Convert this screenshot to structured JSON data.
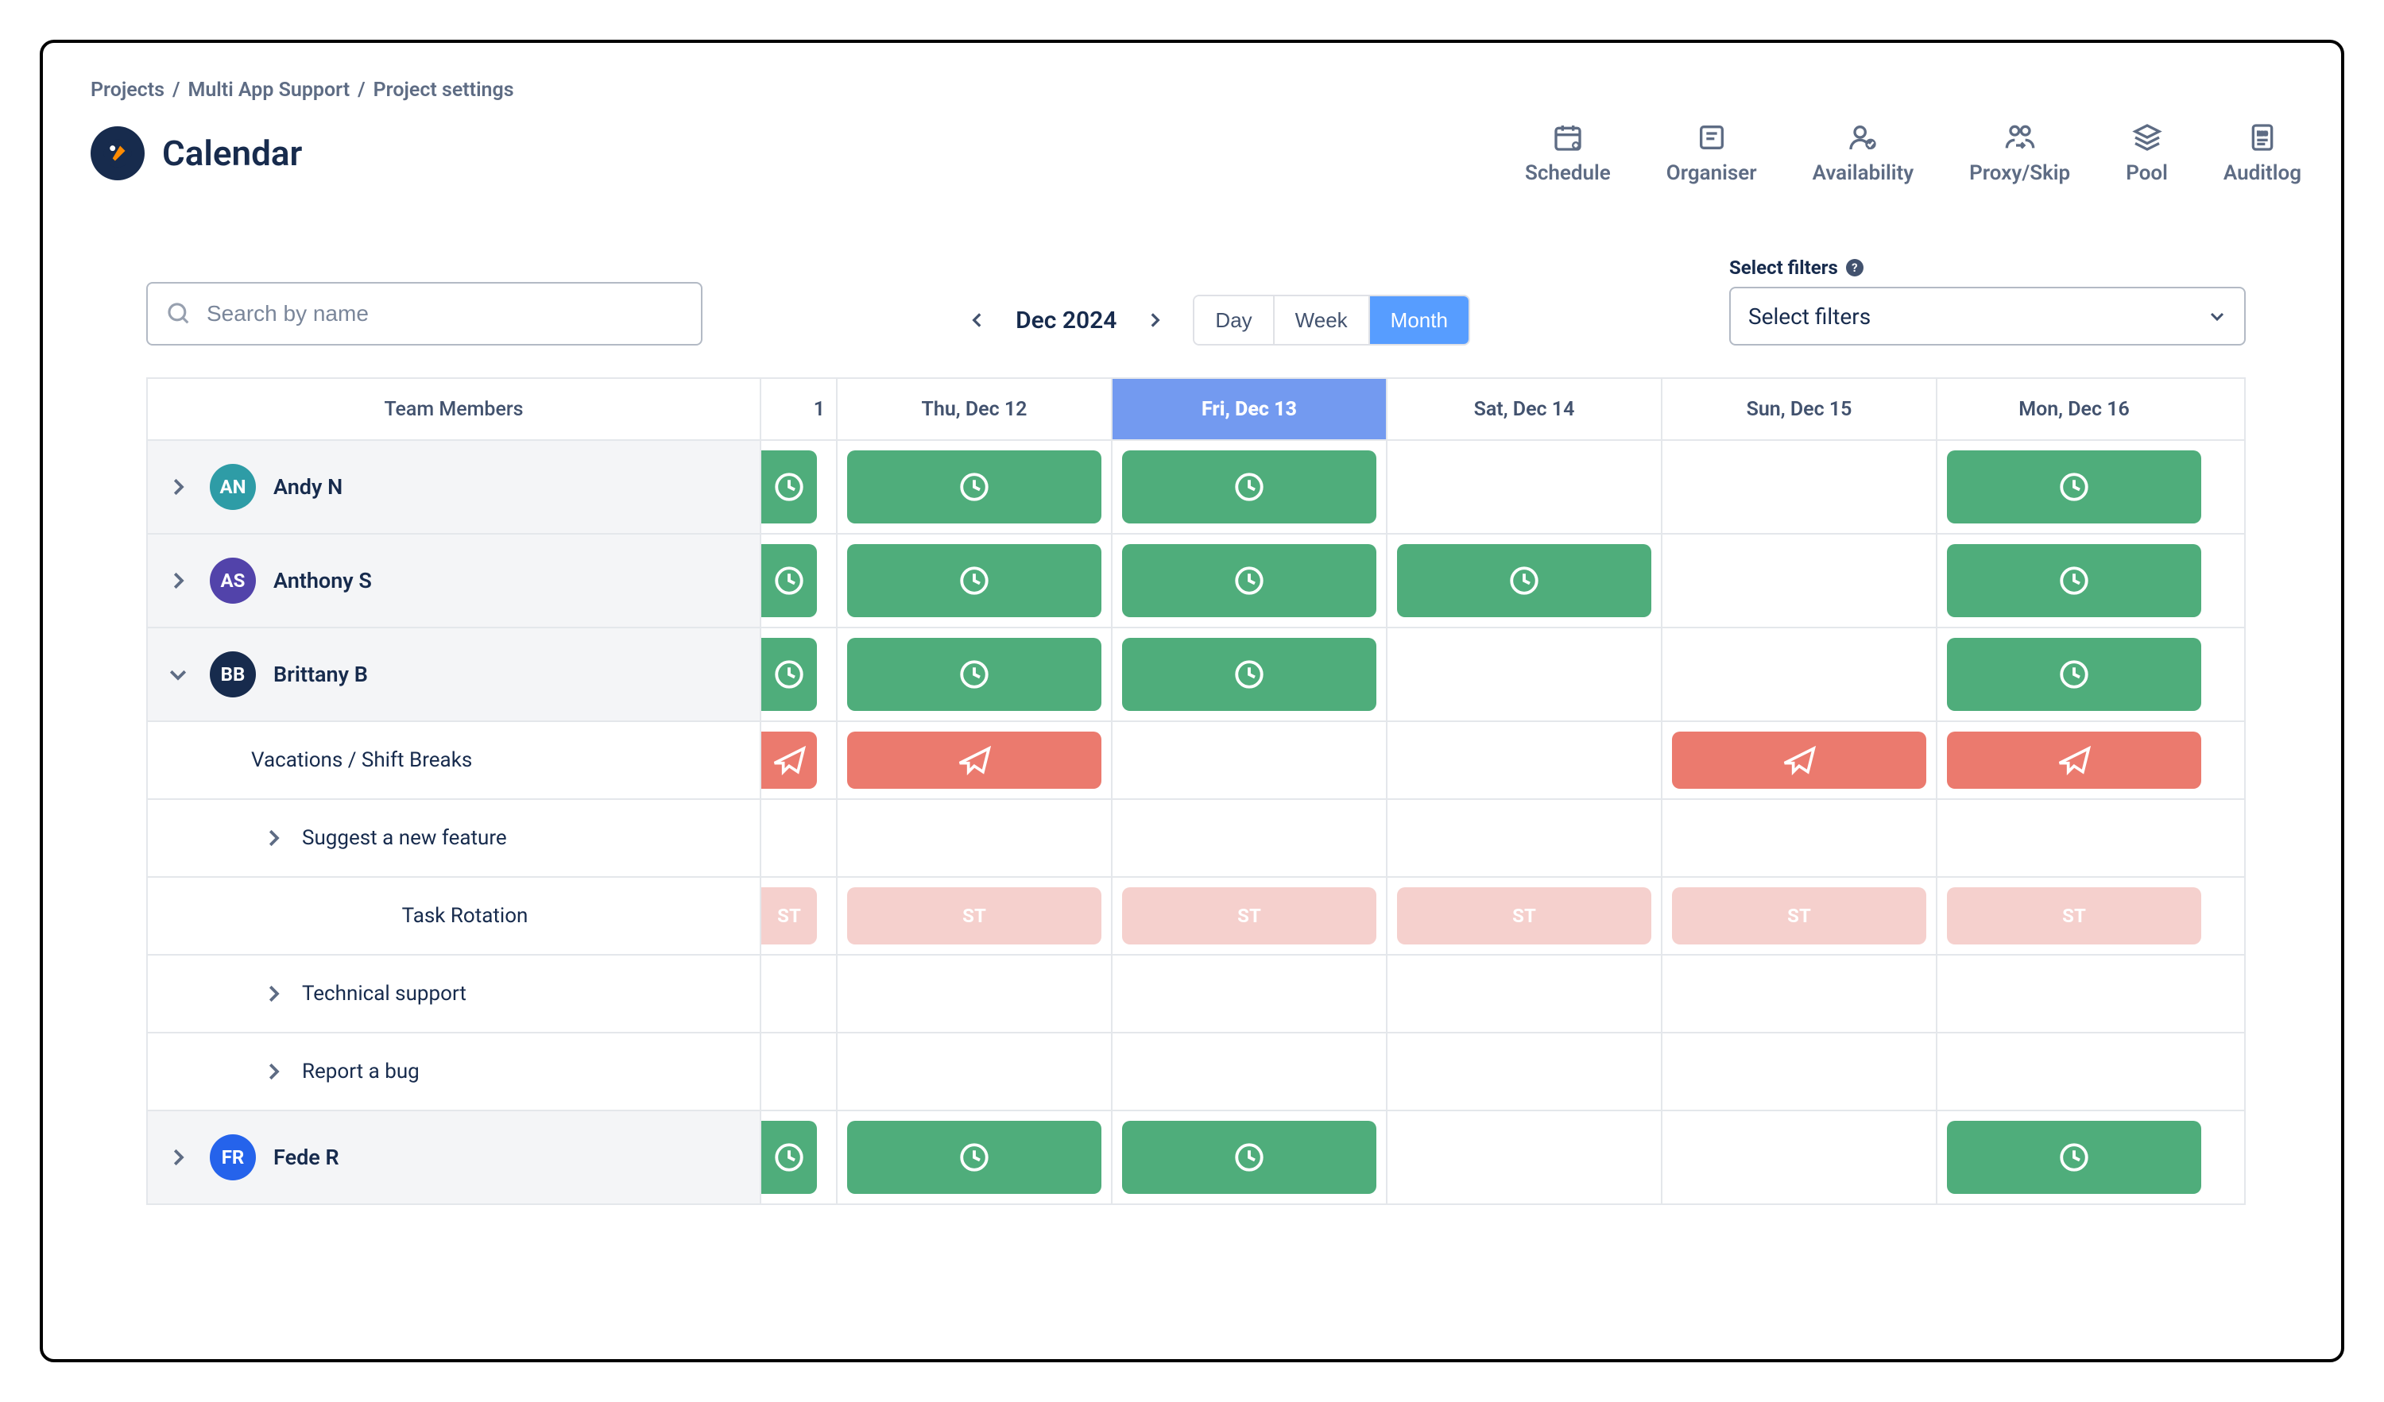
{
  "breadcrumb": [
    "Projects",
    "Multi App Support",
    "Project settings"
  ],
  "page_title": "Calendar",
  "tool_tabs": [
    {
      "id": "schedule",
      "label": "Schedule"
    },
    {
      "id": "organiser",
      "label": "Organiser"
    },
    {
      "id": "availability",
      "label": "Availability"
    },
    {
      "id": "proxyskip",
      "label": "Proxy/Skip"
    },
    {
      "id": "pool",
      "label": "Pool"
    },
    {
      "id": "auditlog",
      "label": "Auditlog"
    }
  ],
  "search_placeholder": "Search by name",
  "month_label": "Dec 2024",
  "view_toggle": {
    "day": "Day",
    "week": "Week",
    "month": "Month",
    "active": "Month"
  },
  "filters_label": "Select filters",
  "filters_value": "Select filters",
  "columns": {
    "members_header": "Team Members",
    "prev_day_num": "1",
    "days": [
      {
        "label": "Thu, Dec 12",
        "today": false
      },
      {
        "label": "Fri, Dec 13",
        "today": true
      },
      {
        "label": "Sat, Dec 14",
        "today": false
      },
      {
        "label": "Sun, Dec 15",
        "today": false
      },
      {
        "label": "Mon, Dec 16",
        "today": false
      }
    ]
  },
  "members": [
    {
      "initials": "AN",
      "name": "Andy N",
      "color": "#2E9CA6",
      "expand": "closed",
      "slots": [
        "green",
        "green",
        "green",
        "",
        "",
        "green"
      ]
    },
    {
      "initials": "AS",
      "name": "Anthony S",
      "color": "#5243AA",
      "expand": "closed",
      "slots": [
        "green",
        "green",
        "green",
        "green",
        "",
        "green"
      ]
    },
    {
      "initials": "BB",
      "name": "Brittany B",
      "color": "#172B4D",
      "expand": "open",
      "slots": [
        "green",
        "green",
        "green",
        "",
        "",
        "green"
      ],
      "subrows": [
        {
          "type": "label",
          "indent": 1,
          "text": "Vacations / Shift Breaks",
          "slots": [
            "red",
            "red",
            "",
            "",
            "red",
            "red"
          ],
          "icon": "plane"
        },
        {
          "type": "chev",
          "indent": 1,
          "text": "Suggest a new feature",
          "slots": [
            "",
            "",
            "",
            "",
            "",
            ""
          ]
        },
        {
          "type": "label",
          "indent": 2,
          "text": "Task Rotation",
          "slots": [
            "pink",
            "pink",
            "pink",
            "pink",
            "pink",
            "pink"
          ],
          "chip_text": "ST"
        },
        {
          "type": "chev",
          "indent": 1,
          "text": "Technical support",
          "slots": [
            "",
            "",
            "",
            "",
            "",
            ""
          ]
        },
        {
          "type": "chev",
          "indent": 1,
          "text": "Report a bug",
          "slots": [
            "",
            "",
            "",
            "",
            "",
            ""
          ]
        }
      ]
    },
    {
      "initials": "FR",
      "name": "Fede R",
      "color": "#2563EB",
      "expand": "closed",
      "slots": [
        "green",
        "green",
        "green",
        "",
        "",
        "green"
      ]
    }
  ]
}
